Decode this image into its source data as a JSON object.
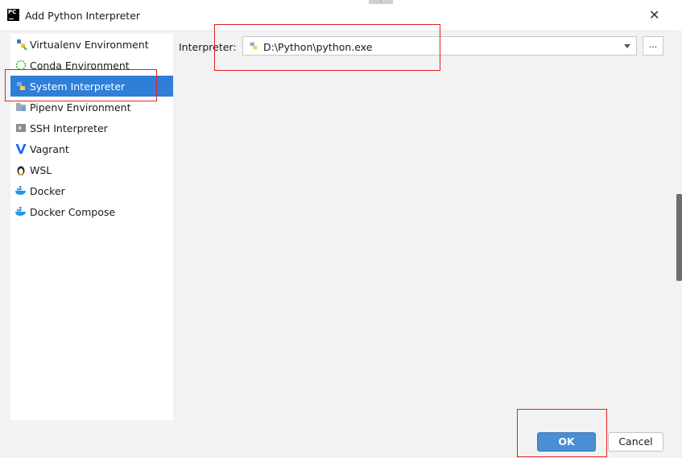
{
  "window": {
    "app_icon": "pycharm-logo-icon",
    "app_icon_text": "PC",
    "title": "Add Python Interpreter",
    "close_icon": "close-icon"
  },
  "sidebar": {
    "items": [
      {
        "label": "Virtualenv Environment",
        "icon": "virtualenv-icon",
        "selected": false
      },
      {
        "label": "Conda Environment",
        "icon": "conda-icon",
        "selected": false
      },
      {
        "label": "System Interpreter",
        "icon": "python-icon",
        "selected": true
      },
      {
        "label": "Pipenv Environment",
        "icon": "pipenv-icon",
        "selected": false
      },
      {
        "label": "SSH Interpreter",
        "icon": "ssh-icon",
        "selected": false
      },
      {
        "label": "Vagrant",
        "icon": "vagrant-icon",
        "selected": false
      },
      {
        "label": "WSL",
        "icon": "linux-penguin-icon",
        "selected": false
      },
      {
        "label": "Docker",
        "icon": "docker-icon",
        "selected": false
      },
      {
        "label": "Docker Compose",
        "icon": "docker-compose-icon",
        "selected": false
      }
    ]
  },
  "interpreter": {
    "label": "Interpreter:",
    "value": "D:\\Python\\python.exe",
    "browse_label": "..."
  },
  "footer": {
    "ok_label": "OK",
    "cancel_label": "Cancel"
  },
  "colors": {
    "selection": "#2f7ed8",
    "ok_button": "#4a8fd4",
    "annotation_box": "#e02020"
  }
}
